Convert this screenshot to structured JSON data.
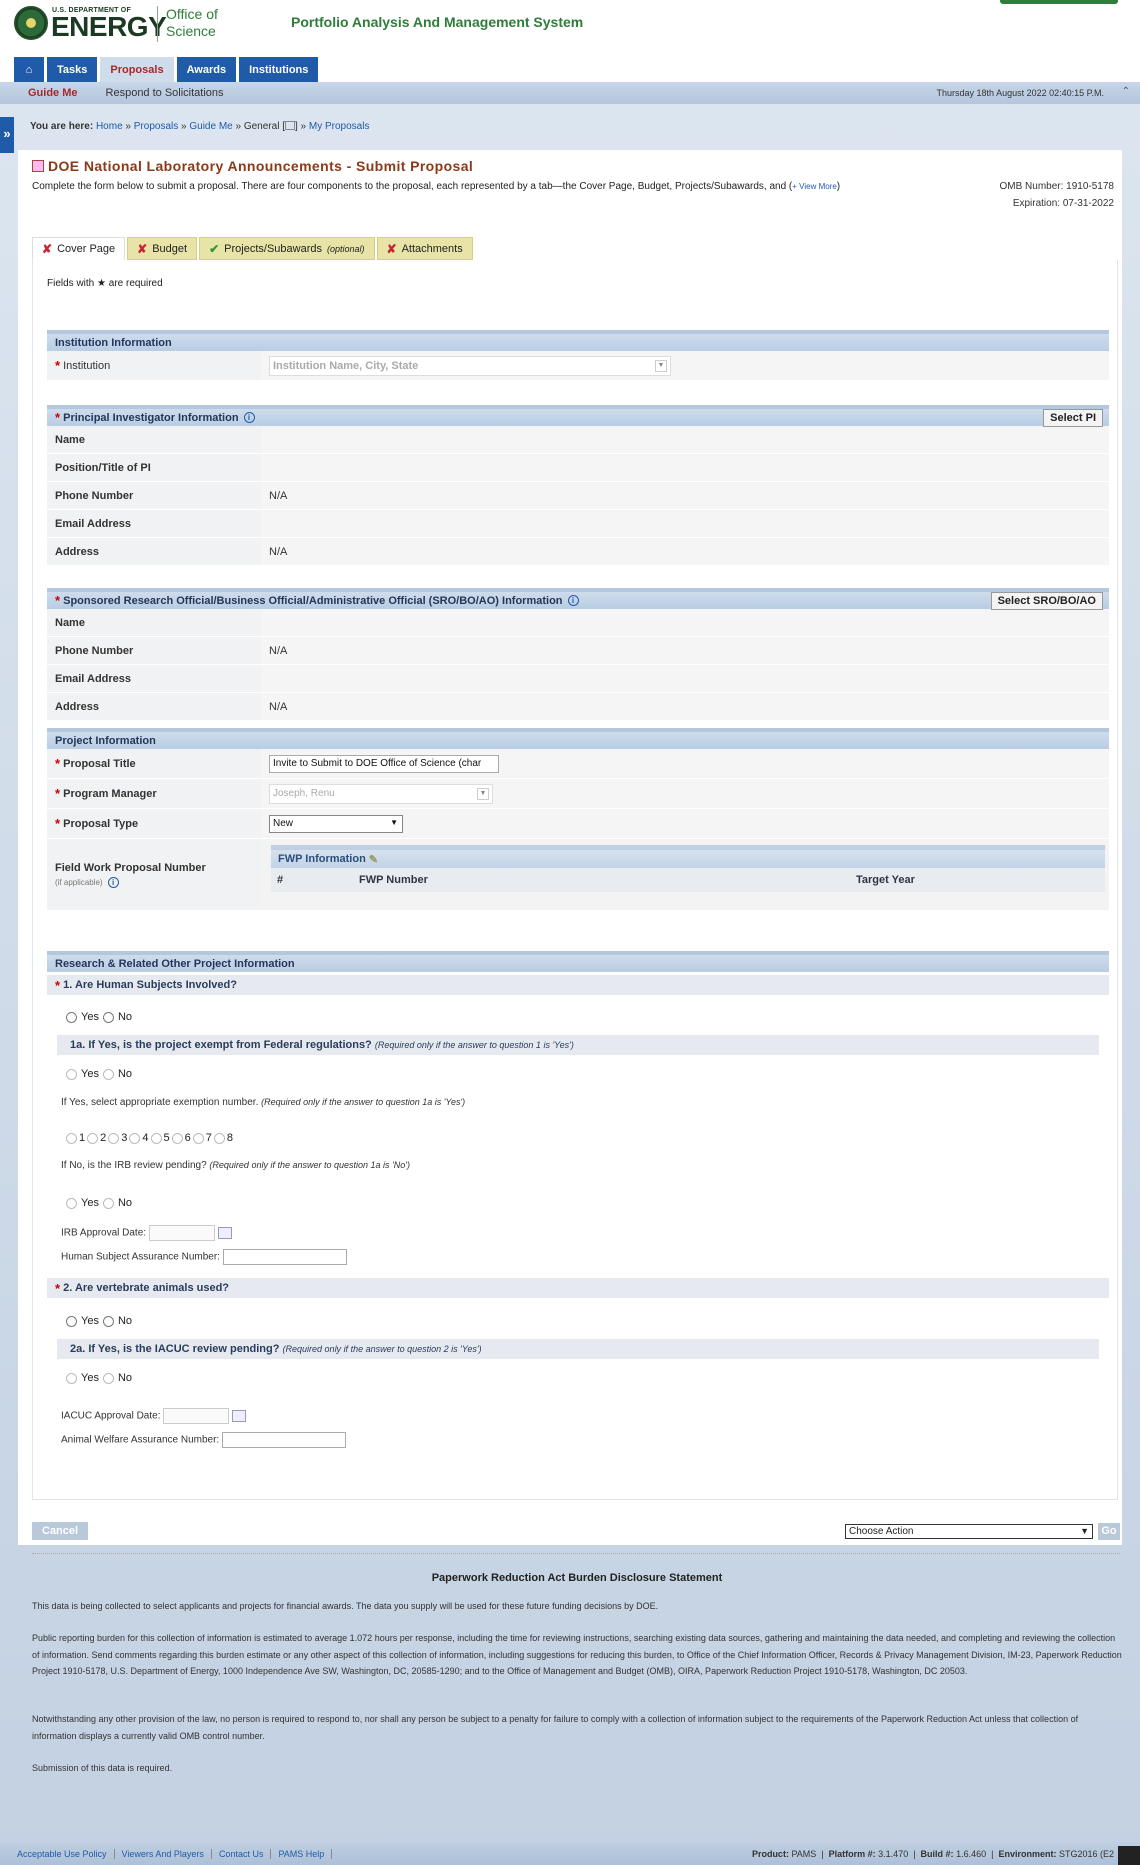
{
  "header": {
    "doe_small": "U.S. DEPARTMENT OF",
    "doe_big": "ENERGY",
    "office": "Office of Science",
    "system_name": "Portfolio Analysis And Management System",
    "tabs": [
      "Tasks",
      "Proposals",
      "Awards",
      "Institutions"
    ],
    "subnav": [
      "Guide Me",
      "Respond to Solicitations"
    ],
    "datetime": "Thursday 18th August 2022 02:40:15 P.M."
  },
  "breadcrumb": {
    "prefix": "You are here:",
    "items": [
      "Home",
      "Proposals",
      "Guide Me",
      "General",
      "My Proposals"
    ]
  },
  "page": {
    "title": "DOE National Laboratory Announcements - Submit Proposal",
    "description": "Complete the form below to submit a proposal. There are four components to the proposal, each represented by a tab—the Cover Page, Budget, Projects/Subawards, and (",
    "view_more": "+ View More",
    "omb_number": "OMB Number: 1910-5178",
    "expiration": "Expiration: 07-31-2022",
    "required_note": "Fields with ★ are required"
  },
  "form_tabs": [
    {
      "label": "Cover Page",
      "note": ""
    },
    {
      "label": "Budget",
      "note": ""
    },
    {
      "label": "Projects/Subawards",
      "note": "(optional)"
    },
    {
      "label": "Attachments",
      "note": ""
    }
  ],
  "institution": {
    "header": "Institution Information",
    "label": "Institution",
    "placeholder": "Institution Name, City, State"
  },
  "pi": {
    "header": "Principal Investigator Information",
    "button": "Select PI",
    "rows": [
      {
        "label": "Name",
        "value": ""
      },
      {
        "label": "Position/Title of PI",
        "value": ""
      },
      {
        "label": "Phone Number",
        "value": "N/A"
      },
      {
        "label": "Email Address",
        "value": ""
      },
      {
        "label": "Address",
        "value": "N/A"
      }
    ]
  },
  "sro": {
    "header": "Sponsored Research Official/Business Official/Administrative Official (SRO/BO/AO) Information",
    "button": "Select SRO/BO/AO",
    "rows": [
      {
        "label": "Name",
        "value": ""
      },
      {
        "label": "Phone Number",
        "value": "N/A"
      },
      {
        "label": "Email Address",
        "value": ""
      },
      {
        "label": "Address",
        "value": "N/A"
      }
    ]
  },
  "project": {
    "header": "Project Information",
    "title_label": "Proposal Title",
    "title_value": "Invite to Submit to DOE Office of Science (char",
    "pm_label": "Program Manager",
    "pm_value": "Joseph,  Renu",
    "type_label": "Proposal Type",
    "type_value": "New",
    "fwp_label": "Field Work Proposal Number",
    "fwp_sub": "(if applicable)",
    "fwp_header": "FWP Information",
    "fwp_cols": [
      "#",
      "FWP Number",
      "Target Year"
    ]
  },
  "research": {
    "header": "Research & Related Other Project Information",
    "q1": "1. Are Human Subjects Involved?",
    "q1a": "1a. If Yes, is the project exempt from Federal regulations?",
    "q1a_note": "(Required only if the answer to question 1 is 'Yes')",
    "exempt_label": "If Yes, select appropriate exemption number.",
    "exempt_note": "(Required only if the answer to question 1a is 'Yes')",
    "exempt_options": [
      "1",
      "2",
      "3",
      "4",
      "5",
      "6",
      "7",
      "8"
    ],
    "irb_label": "If No, is the IRB review pending?",
    "irb_note": "(Required only if the answer to question 1a is 'No')",
    "irb_date": "IRB Approval Date:",
    "hsa": "Human Subject Assurance Number:",
    "q2": "2. Are vertebrate animals used?",
    "q2a": "2a. If Yes, is the IACUC review pending?",
    "q2a_note": "(Required only if the answer to question 2 is 'Yes')",
    "iacuc_date": "IACUC Approval Date:",
    "awa": "Animal Welfare Assurance Number:",
    "yes": "Yes",
    "no": "No"
  },
  "actions": {
    "cancel": "Cancel",
    "choose": "Choose Action",
    "go": "Go"
  },
  "paperwork": {
    "title": "Paperwork Reduction Act Burden Disclosure Statement",
    "p1": "This data is being collected to select applicants and projects for financial awards. The data you supply will be used for these future funding decisions by DOE.",
    "p2": "Public reporting burden for this collection of information is estimated to average 1.072 hours per response, including the time for reviewing instructions, searching existing data sources, gathering and maintaining the data needed, and completing and reviewing the collection of information. Send comments regarding this burden estimate or any other aspect of this collection of information, including suggestions for reducing this burden, to Office of the Chief Information Officer, Records & Privacy Management Division, IM-23, Paperwork Reduction Project 1910-5178, U.S. Department of Energy, 1000 Independence Ave SW, Washington, DC, 20585-1290; and to the Office of Management and Budget (OMB), OIRA, Paperwork Reduction Project 1910-5178, Washington, DC 20503.",
    "p3": "Notwithstanding any other provision of the law, no person is required to respond to, nor shall any person be subject to a penalty for failure to comply with a collection of information subject to the requirements of the Paperwork Reduction Act unless that collection of information displays a currently valid OMB control number.",
    "p4": "Submission of this data is required."
  },
  "footer": {
    "links": [
      "Acceptable Use Policy",
      "Viewers And Players",
      "Contact Us",
      "PAMS Help"
    ],
    "product_label": "Product:",
    "product": "PAMS",
    "platform_label": "Platform #:",
    "platform": "3.1.470",
    "build_label": "Build #:",
    "build": "1.6.460",
    "env_label": "Environment:",
    "env": "STG2016 (E2"
  }
}
